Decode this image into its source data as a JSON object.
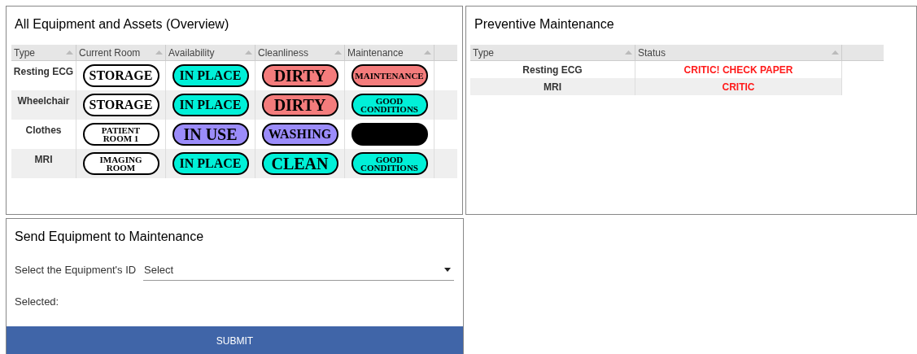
{
  "overview": {
    "title": "All Equipment and Assets (Overview)",
    "columns": [
      "Type",
      "Current Room",
      "Availability",
      "Cleanliness",
      "Maintenance"
    ],
    "rows": [
      {
        "type": "Resting ECG",
        "badges": [
          {
            "label": "STORAGE",
            "color": "#ffffff"
          },
          {
            "label": "IN PLACE",
            "color": "#00f0d8"
          },
          {
            "label": "DIRTY",
            "color": "#f47c7c"
          },
          {
            "label": "MAINTENANCE",
            "color": "#f47c7c"
          }
        ]
      },
      {
        "type": "Wheelchair",
        "badges": [
          {
            "label": "STORAGE",
            "color": "#ffffff"
          },
          {
            "label": "IN PLACE",
            "color": "#00f0d8"
          },
          {
            "label": "DIRTY",
            "color": "#f47c7c"
          },
          {
            "label": "GOOD CONDITIONS",
            "color": "#00f0d8"
          }
        ]
      },
      {
        "type": "Clothes",
        "badges": [
          {
            "label": "PATIENT ROOM 1",
            "color": "#ffffff"
          },
          {
            "label": "IN USE",
            "color": "#9b8cfa"
          },
          {
            "label": "WASHING",
            "color": "#9b8cfa"
          },
          {
            "color": "#000000"
          }
        ]
      },
      {
        "type": "MRI",
        "badges": [
          {
            "label": "IMAGING ROOM",
            "color": "#ffffff"
          },
          {
            "label": "IN PLACE",
            "color": "#00f0d8"
          },
          {
            "label": "CLEAN",
            "color": "#00f0d8"
          },
          {
            "label": "GOOD CONDITIONS",
            "color": "#00f0d8"
          }
        ]
      }
    ]
  },
  "preventive": {
    "title": "Preventive Maintenance",
    "columns": [
      "Type",
      "Status"
    ],
    "rows": [
      {
        "type": "Resting ECG",
        "status": "CRITIC! CHECK PAPER"
      },
      {
        "type": "MRI",
        "status": "CRITIC"
      }
    ]
  },
  "send": {
    "title": "Send Equipment to Maintenance",
    "select_label": "Select the Equipment's ID",
    "select_value": "Select",
    "selected_label": "Selected:",
    "submit": "SUBMIT"
  }
}
